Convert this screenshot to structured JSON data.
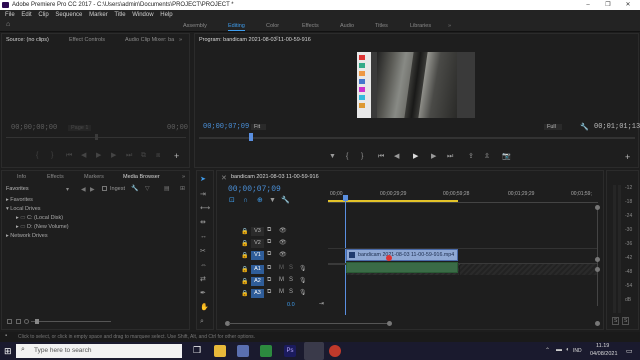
{
  "window": {
    "title": "Adobe Premiere Pro CC 2017 - C:\\Users\\admin\\Documents\\PROJECT\\PROJECT *",
    "minimize": "–",
    "maximize": "❐",
    "close": "✕"
  },
  "menu": [
    "File",
    "Edit",
    "Clip",
    "Sequence",
    "Marker",
    "Title",
    "Window",
    "Help"
  ],
  "workspaces": [
    "Assembly",
    "Editing",
    "Color",
    "Effects",
    "Audio",
    "Titles",
    "Libraries"
  ],
  "workspace_active": "Editing",
  "source_panel": {
    "tabs": [
      "Source: (no clips)",
      "Effect Controls",
      "Audio Clip Mixer: ba"
    ],
    "tab_more": "»",
    "timecode_left": "00;00;00;00",
    "timecode_right": "00;00",
    "fit_label": "Page 1"
  },
  "program_panel": {
    "title": "Program: bandicam 2021-08-03 11-00-59-916",
    "menu_icon": "≡",
    "timecode": "00;00;07;09",
    "zoom": "Fit",
    "quality": "Full",
    "duration": "00;01;01;13"
  },
  "project_panel": {
    "tabs": [
      "Info",
      "Effects",
      "Markers",
      "Media Browser"
    ],
    "tab_more": "»",
    "favorites_dropdown": "Favorites",
    "ingest_label": "Ingest",
    "tree": [
      {
        "label": "Favorites",
        "level": 0
      },
      {
        "label": "Local Drives",
        "level": 0
      },
      {
        "label": "C: (Local Disk)",
        "level": 1
      },
      {
        "label": "D: (New Volume)",
        "level": 1
      },
      {
        "label": "Network Drives",
        "level": 0
      }
    ]
  },
  "timeline": {
    "tab": "bandicam 2021-08-03 11-00-59-916",
    "timecode": "00;00;07;09",
    "ruler": [
      "00;00",
      "00;00;29;29",
      "00;00;59;28",
      "00;01;29;29",
      "00;01;59;"
    ],
    "video_tracks": [
      "V3",
      "V2",
      "V1"
    ],
    "audio_tracks": [
      "A1",
      "A2",
      "A3"
    ],
    "clip_name": "bandicam 2021-08-03 11-00-59-916.mp4",
    "fx_badge": "fx",
    "master_value": "0.0"
  },
  "meter": {
    "labels": [
      "-12",
      "-18",
      "-24",
      "-30",
      "-36",
      "-42",
      "-48",
      "-54",
      "dB"
    ],
    "solo": "S",
    "solo2": "S"
  },
  "status_bar": "Click to select, or click in empty space and drag to marquee select. Use Shift, Alt, and Ctrl for other options.",
  "taskbar": {
    "search_placeholder": "Type here to search",
    "time": "11.19",
    "date": "04/08/2021",
    "lang": "IND"
  },
  "colors": {
    "accent": "#3f9ded",
    "timecode_blue": "#4a90d9",
    "clip_video": "#8fa8d4",
    "clip_audio": "#3a6b46",
    "playhead": "#5a8fe0"
  }
}
